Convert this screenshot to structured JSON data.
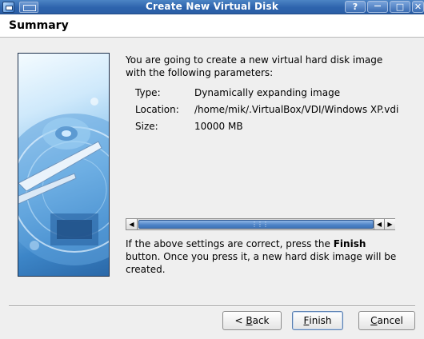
{
  "window": {
    "title": "Create New Virtual Disk",
    "controls": {
      "help": "?",
      "minimize": "—",
      "maximize": "□",
      "close": "✕"
    }
  },
  "header": {
    "title": "Summary"
  },
  "intro": {
    "line1": "You are going to create a new virtual hard disk image",
    "line2": "with the following parameters:"
  },
  "params": [
    {
      "label": "Type:",
      "value": "Dynamically expanding image"
    },
    {
      "label": "Location:",
      "value": "/home/mik/.VirtualBox/VDI/Windows XP.vdi"
    },
    {
      "label": "Size:",
      "value": "10000 MB"
    }
  ],
  "outro": {
    "pre": "If the above settings are correct, press the ",
    "bold": "Finish",
    "line2": "button. Once you press it, a new hard disk image will be",
    "line3": "created."
  },
  "buttons": {
    "back": {
      "pre": "< ",
      "mnemonic": "B",
      "rest": "ack"
    },
    "finish": {
      "mnemonic": "F",
      "rest": "inish"
    },
    "cancel": {
      "mnemonic": "C",
      "rest": "ancel"
    }
  },
  "scrollbar": {
    "grip": "⋮⋮⋮",
    "left_arrow": "◀",
    "right_arrow": "▶"
  },
  "colors": {
    "titlebar": "#2e64ad",
    "accent": "#4c82c6"
  }
}
